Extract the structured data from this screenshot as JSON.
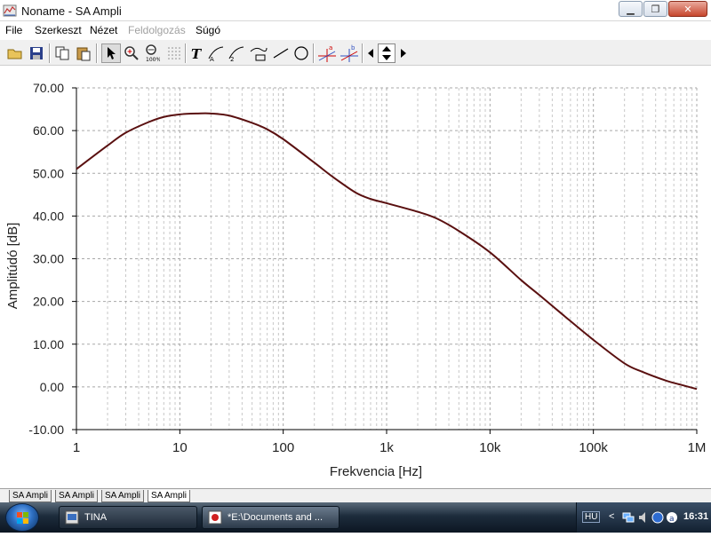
{
  "window": {
    "title": "Noname - SA Ampli",
    "buttons": [
      "minimize-icon",
      "maximize-icon",
      "close-icon"
    ]
  },
  "menu": {
    "file": "File",
    "edit": "Szerkeszt",
    "view": "Nézet",
    "process": "Feldolgozás",
    "help": "Súgó"
  },
  "toolbar": {
    "icons": [
      "open-folder-icon",
      "save-icon",
      "copy-icon",
      "paste-icon",
      "pointer-icon",
      "zoom-in-icon",
      "zoom-100-icon",
      "grid-icon",
      "text-icon",
      "curve-label-icon",
      "curve-label-2-icon",
      "curve-label-3-icon",
      "line-icon",
      "circle-icon",
      "cursor-a-icon",
      "cursor-b-icon",
      "arrow-left-icon",
      "arrow-updown-icon",
      "arrow-right-icon"
    ]
  },
  "chart_data": {
    "type": "line",
    "xlabel": "Frekvencia [Hz]",
    "ylabel": "Amplitúdó [dB]",
    "x_scale": "log",
    "xlim": [
      1,
      1000000
    ],
    "ylim": [
      -10,
      70
    ],
    "x_ticks": [
      "1",
      "10",
      "100",
      "1k",
      "10k",
      "100k",
      "1M"
    ],
    "y_ticks": [
      "70.00",
      "60.00",
      "50.00",
      "40.00",
      "30.00",
      "20.00",
      "10.00",
      "0.00",
      "-10.00"
    ],
    "grid": true,
    "series": [
      {
        "color": "#5a1010",
        "x": [
          1,
          2,
          3,
          5,
          7,
          10,
          15,
          20,
          30,
          50,
          70,
          100,
          200,
          300,
          500,
          700,
          1000,
          2000,
          3000,
          5000,
          10000,
          20000,
          30000,
          50000,
          100000,
          200000,
          300000,
          500000,
          700000,
          1000000
        ],
        "y": [
          51,
          56.5,
          59.5,
          62,
          63.2,
          63.8,
          64,
          64,
          63.5,
          61.8,
          60.3,
          58,
          52.5,
          49.2,
          45.5,
          44,
          43,
          41,
          39.5,
          36.5,
          31.5,
          25,
          21.5,
          17,
          11,
          5.5,
          3.5,
          1.5,
          0.5,
          -0.5
        ]
      }
    ]
  },
  "tabs": [
    "SA Ampli",
    "SA Ampli",
    "SA Ampli",
    "SA Ampli"
  ],
  "taskbar": {
    "items": [
      {
        "label": "TINA",
        "icon": "tina-icon"
      },
      {
        "label": "*E:\\Documents and ...",
        "icon": "document-icon"
      }
    ],
    "lang": "HU",
    "chevron": "<",
    "clock": "16:31"
  }
}
